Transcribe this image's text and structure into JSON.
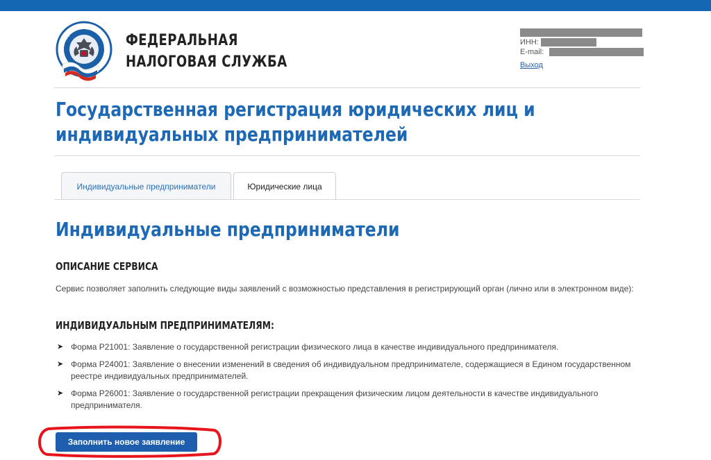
{
  "header": {
    "org_name_line1": "ФЕДЕРАЛЬНАЯ",
    "org_name_line2": "НАЛОГОВАЯ СЛУЖБА",
    "logo_text": "ФЕДЕРАЛЬНАЯ НАЛОГОВАЯ СЛУЖБА",
    "brand_color": "#1467b3",
    "user": {
      "inn_label": "ИНН:",
      "email_label": "E-mail:",
      "logout_label": "Выход"
    }
  },
  "page": {
    "title_line1": "Государственная регистрация юридических лиц и",
    "title_line2": "индивидуальных предпринимателей",
    "title_color": "#1e69b5"
  },
  "tabs": [
    {
      "label": "Индивидуальные предприниматели",
      "active": true
    },
    {
      "label": "Юридические лица",
      "active": false
    }
  ],
  "section": {
    "title": "Индивидуальные предприниматели",
    "service_heading": "ОПИСАНИЕ СЕРВИСА",
    "description": "Сервис позволяет заполнить следующие виды заявлений с возможностью представления в регистрирующий орган (лично или в электронном виде):",
    "ip_heading": "ИНДИВИДУАЛЬНЫМ ПРЕДПРИНИМАТЕЛЯМ:",
    "forms": [
      "Форма Р21001: Заявление о государственной регистрации физического лица в качестве индивидуального предпринимателя.",
      "Форма Р24001: Заявление о внесении изменений в сведения об индивидуальном предпринимателе, содержащиеся в Едином государственном реестре индивидуальных предпринимателей.",
      "Форма Р26001: Заявление о государственной регистрации прекращения физическим лицом деятельности в качестве индивидуального предпринимателя."
    ],
    "fill_button_label": "Заполнить новое заявление",
    "button_color": "#1d5fae",
    "highlight_color": "#e8141c"
  }
}
